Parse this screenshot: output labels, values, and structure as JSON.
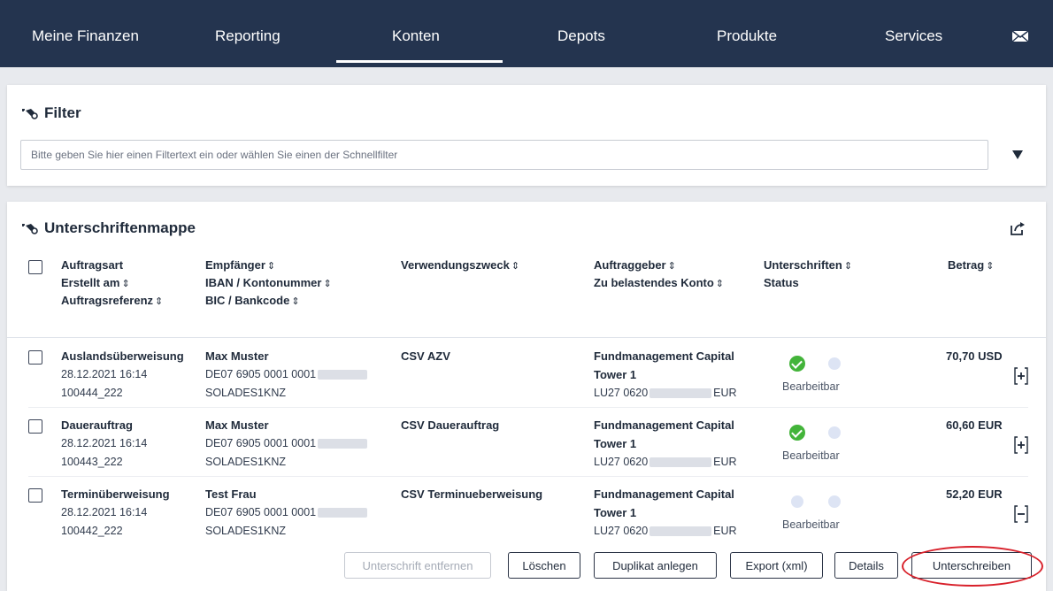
{
  "nav": {
    "items": [
      "Meine Finanzen",
      "Reporting",
      "Konten",
      "Depots",
      "Produkte",
      "Services"
    ],
    "active": "Konten",
    "mail_icon": "mail-icon"
  },
  "filter": {
    "title": "Filter",
    "placeholder": "Bitte geben Sie hier einen Filtertext ein oder wählen Sie einen der Schnellfilter"
  },
  "list": {
    "title": "Unterschriftenmappe",
    "headers": {
      "col1": [
        "Auftragsart",
        "Erstellt am",
        "Auftragsreferenz"
      ],
      "col2": [
        "Empfänger",
        "IBAN / Kontonummer",
        "BIC / Bankcode"
      ],
      "col3": [
        "Verwendungszweck"
      ],
      "col4": [
        "Auftraggeber",
        "Zu belastendes Konto"
      ],
      "col5": [
        "Unterschriften",
        "Status"
      ],
      "col6": [
        "Betrag"
      ]
    },
    "rows": [
      {
        "type": "Auslandsüberweisung",
        "date": "28.12.2021 16:14",
        "ref": "100444_222",
        "recipient": "Max Muster",
        "iban": "DE07 6905 0001 0001",
        "bic": "SOLADES1KNZ",
        "purpose": "CSV AZV",
        "payer_1": "Fundmanagement Capital",
        "payer_2": "Tower 1",
        "account_start": "LU27 0620",
        "account_end": "EUR",
        "status": "Bearbeitbar",
        "amount": "70,70 USD"
      },
      {
        "type": "Dauerauftrag",
        "date": "28.12.2021 16:14",
        "ref": "100443_222",
        "recipient": "Max Muster",
        "iban": "DE07 6905 0001 0001",
        "bic": "SOLADES1KNZ",
        "purpose": "CSV Dauerauftrag",
        "payer_1": "Fundmanagement Capital",
        "payer_2": "Tower 1",
        "account_start": "LU27 0620",
        "account_end": "EUR",
        "status": "Bearbeitbar",
        "amount": "60,60 EUR"
      },
      {
        "type": "Terminüberweisung",
        "date": "28.12.2021 16:14",
        "ref": "100442_222",
        "recipient": "Test Frau",
        "iban": "DE07 6905 0001 0001",
        "bic": "SOLADES1KNZ",
        "purpose": "CSV Terminueberweisung",
        "payer_1": "Fundmanagement Capital",
        "payer_2": "Tower 1",
        "account_start": "LU27 0620",
        "account_end": "EUR",
        "status": "Bearbeitbar",
        "amount": "52,20 EUR"
      }
    ]
  },
  "actions": {
    "remove_signature": "Unterschrift entfernen",
    "delete": "Löschen",
    "duplicate": "Duplikat anlegen",
    "export": "Export (xml)",
    "details": "Details",
    "sign": "Unterschreiben"
  },
  "colors": {
    "nav_bg": "#24344f",
    "status_ok": "#43b43a",
    "highlight": "#d8202a"
  }
}
